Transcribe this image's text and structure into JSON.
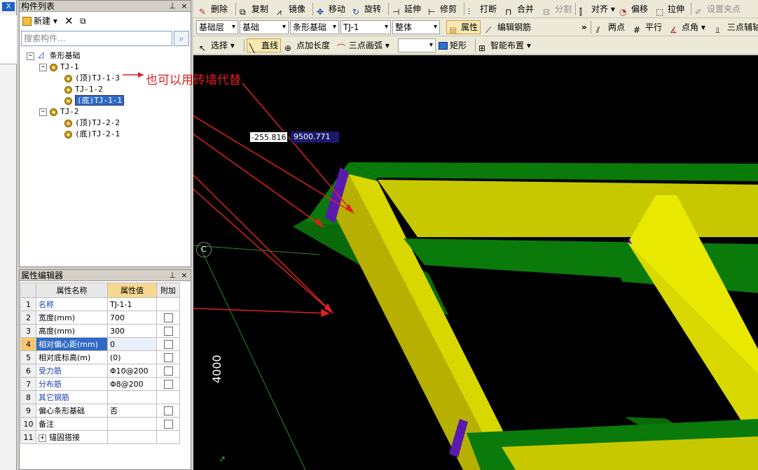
{
  "left_strip": {
    "close_label": "X"
  },
  "component_panel": {
    "title": "构件列表",
    "pin_icon": "pin-icon",
    "close_label": "×",
    "new_label": "新建",
    "delete_icon": "delete-icon",
    "copy_icon": "copy-icon",
    "search_placeholder": "搜索构件...",
    "tree": {
      "root": "条形基础",
      "groups": [
        {
          "name": "TJ-1",
          "children": [
            "(顶)TJ-1-3",
            "TJ-1-2",
            "(底)TJ-1-1"
          ]
        },
        {
          "name": "TJ-2",
          "children": [
            "(顶)TJ-2-2",
            "(底)TJ-2-1"
          ]
        }
      ]
    }
  },
  "property_panel": {
    "title": "属性编辑器",
    "close_label": "×",
    "headers": {
      "name": "属性名称",
      "value": "属性值",
      "extra": "附加"
    },
    "rows": [
      {
        "no": "1",
        "name": "名称",
        "value": "TJ-1-1",
        "has_check": false,
        "blue": true
      },
      {
        "no": "2",
        "name": "宽度(mm)",
        "value": "700",
        "has_check": true,
        "blue": false
      },
      {
        "no": "3",
        "name": "高度(mm)",
        "value": "300",
        "has_check": true,
        "blue": false
      },
      {
        "no": "4",
        "name": "相对偏心距(mm)",
        "value": "0",
        "has_check": true,
        "blue": false
      },
      {
        "no": "5",
        "name": "相对底标高(m)",
        "value": "(0)",
        "has_check": true,
        "blue": false
      },
      {
        "no": "6",
        "name": "受力筋",
        "value": "Φ10@200",
        "has_check": true,
        "blue": true
      },
      {
        "no": "7",
        "name": "分布筋",
        "value": "Φ8@200",
        "has_check": true,
        "blue": true
      },
      {
        "no": "8",
        "name": "其它钢筋",
        "value": "",
        "has_check": false,
        "blue": true
      },
      {
        "no": "9",
        "name": "偏心条形基础",
        "value": "否",
        "has_check": true,
        "blue": false
      },
      {
        "no": "10",
        "name": "备注",
        "value": "",
        "has_check": true,
        "blue": false
      },
      {
        "no": "11",
        "name": "锚固搭接",
        "value": "",
        "has_check": false,
        "blue": false,
        "expand": true
      }
    ]
  },
  "toolbar1": {
    "delete": "删除",
    "copy": "复制",
    "mirror": "镜像",
    "move": "移动",
    "rotate": "旋转",
    "extend": "延伸",
    "trim": "修剪",
    "break": "打断",
    "merge": "合并",
    "split": "分割",
    "align": "对齐",
    "offset": "偏移",
    "stretch": "拉伸",
    "set_grip": "设置夹点"
  },
  "toolbar2": {
    "floor": "基础层",
    "category": "基础",
    "type": "条形基础",
    "component": "TJ-1",
    "part": "整体",
    "property": "属性",
    "edit_rebar": "编辑钢筋",
    "more": "»",
    "two_point": "两点",
    "parallel": "平行",
    "point_angle": "点角",
    "three_point_aux": "三点辅轴"
  },
  "toolbar3": {
    "select": "选择",
    "line": "直线",
    "point_length": "点加长度",
    "three_point_arc": "三点画弧",
    "rectangle": "矩形",
    "smart_layout": "智能布置"
  },
  "viewport": {
    "coord_x": "-255.816",
    "coord_y": "9500.771",
    "annotation": "也可以用砖墙代替",
    "dimension": "4000",
    "compass": "C",
    "colors": {
      "green": "#0a7a0a",
      "yellow": "#d8d800",
      "purple": "#5a1ab0",
      "arrow": "#e02020"
    }
  }
}
